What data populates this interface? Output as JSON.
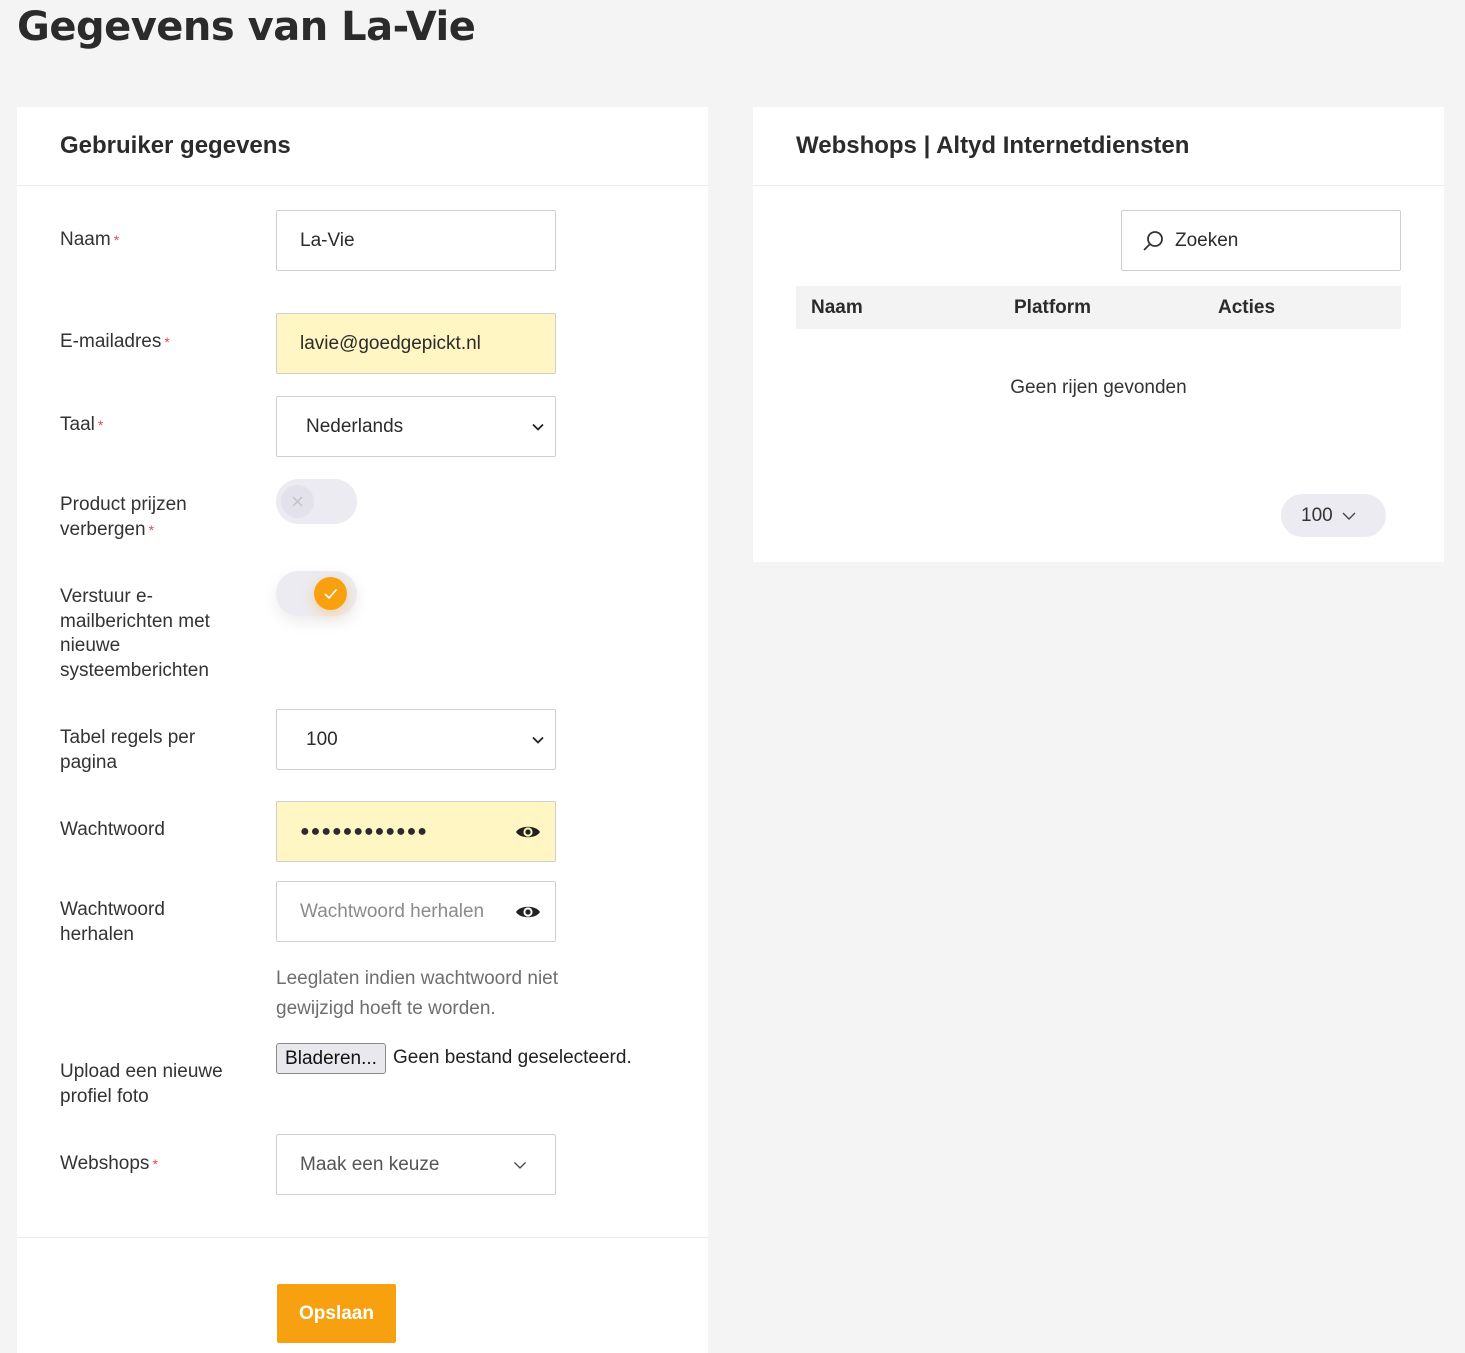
{
  "page": {
    "title": "Gegevens van La-Vie"
  },
  "user_card": {
    "title": "Gebruiker gegevens",
    "required_mark": "*",
    "fields": {
      "name": {
        "label": "Naam",
        "value": "La-Vie"
      },
      "email": {
        "label": "E-mailadres",
        "value": "lavie@goedgepickt.nl"
      },
      "language": {
        "label": "Taal",
        "value": "Nederlands"
      },
      "hide_prices": {
        "label": "Product prijzen verbergen",
        "checked": false
      },
      "system_emails": {
        "label": "Verstuur e-mailberichten met nieuwe systeemberichten",
        "checked": true
      },
      "rows_per_page": {
        "label": "Tabel regels per pagina",
        "value": "100"
      },
      "password": {
        "label": "Wachtwoord",
        "value": "●●●●●●●●●●●●"
      },
      "password_repeat": {
        "label": "Wachtwoord herhalen",
        "placeholder": "Wachtwoord herhalen"
      },
      "password_help": "Leeglaten indien wachtwoord niet gewijzigd hoeft te worden.",
      "photo": {
        "label": "Upload een nieuwe profiel foto",
        "button": "Bladeren...",
        "status": "Geen bestand geselecteerd."
      },
      "webshops": {
        "label": "Webshops",
        "placeholder": "Maak een keuze"
      }
    },
    "save_label": "Opslaan"
  },
  "webshops_card": {
    "title": "Webshops | Altyd Internetdiensten",
    "search_placeholder": "Zoeken",
    "columns": [
      "Naam",
      "Platform",
      "Acties"
    ],
    "empty_text": "Geen rijen gevonden",
    "page_size": "100"
  },
  "colors": {
    "accent": "#f8a110",
    "autofill": "#fff6c4",
    "required": "#e64a4a"
  }
}
